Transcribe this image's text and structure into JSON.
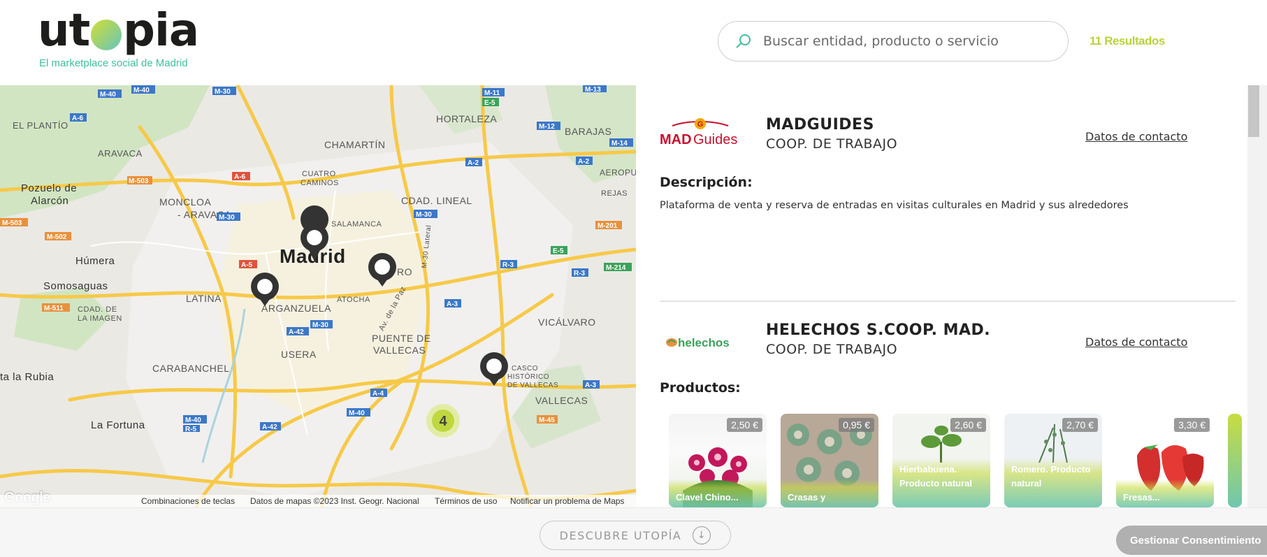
{
  "header": {
    "logo_text": "utopia",
    "tagline": "El marketplace social de Madrid",
    "search_placeholder": "Buscar entidad, producto o servicio",
    "results_count": "11 Resultados",
    "accent_color": "#b9d23d"
  },
  "map": {
    "labels": [
      "EL PLANTÍO",
      "ARAVACA",
      "Pozuelo de",
      "Alarcón",
      "MONCLOA",
      "- ARAVACA",
      "Húmera",
      "Somosaguas",
      "CHAMARTÍN",
      "CUATRO",
      "CAMINOS",
      "HORTALEZA",
      "BARAJAS",
      "AEROPU",
      "REJAS",
      "CDAD. LINEAL",
      "SALAMANCA",
      "Madrid",
      "LATINA",
      "ARGANZUELA",
      "ATOCHA",
      "CDAD. DE",
      "LA IMAGEN",
      "PUENTE DE",
      "VALLECAS",
      "USERA",
      "VICÁLVARO",
      "CARABANCHEL",
      "CASCO",
      "HISTÓRICO",
      "DE VALLECAS",
      "VALLECAS",
      "La Fortuna",
      "ta la Rubia",
      "Av. de la Paz",
      "M-30 Lateral",
      "RO"
    ],
    "road_signs": [
      "M-40",
      "M-40",
      "M-30",
      "A-6",
      "M-503",
      "A-6",
      "M-30",
      "M-503",
      "M-502",
      "A-5",
      "M-511",
      "M-11",
      "E-5",
      "M-12",
      "A-2",
      "A-2",
      "M-14",
      "M-13",
      "M-201",
      "E-5",
      "R-3",
      "R-3",
      "M-214",
      "A-3",
      "M-30",
      "A-42",
      "A-3",
      "A-4",
      "M-40",
      "M-40",
      "A-42",
      "R-5",
      "M-45",
      "M-30"
    ],
    "cluster_count": "4",
    "footer": {
      "shortcuts": "Combinaciones de teclas",
      "map_data": "Datos de mapas ©2023 Inst. Geogr. Nacional",
      "terms": "Términos de uso",
      "report": "Notificar un problema de Maps"
    },
    "google": "Google"
  },
  "entities": [
    {
      "name": "MADGUIDES",
      "type": "COOP. DE TRABAJO",
      "contact_label": "Datos de contacto",
      "logo_text": "MADGuides",
      "section_title": "Descripción:",
      "description": "Plataforma de venta y reserva de entradas en visitas culturales en Madrid y sus alrededores"
    },
    {
      "name": "HELECHOS S.COOP. MAD.",
      "type": "COOP. DE TRABAJO",
      "contact_label": "Datos de contacto",
      "logo_text": "helechos",
      "section_title": "Productos:",
      "products": [
        {
          "price": "2,50 €",
          "name": "Clavel Chino..."
        },
        {
          "price": "0,95 €",
          "name": "Crasas y suculentas"
        },
        {
          "price": "2,60 €",
          "name": "Hierbabuena. Producto natural"
        },
        {
          "price": "2,70 €",
          "name": "Romero. Producto natural"
        },
        {
          "price": "3,30 €",
          "name": "Fresas..."
        }
      ]
    }
  ],
  "footer": {
    "discover_label": "DESCUBRE UTOPÍA",
    "consent_label": "Gestionar Consentimiento"
  }
}
